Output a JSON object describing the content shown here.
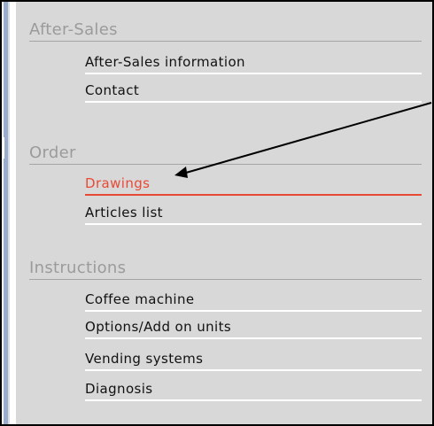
{
  "sections": [
    {
      "title": "After-Sales",
      "items": [
        "After-Sales information",
        "Contact"
      ]
    },
    {
      "title": "Order",
      "items": [
        "Drawings",
        "Articles list"
      ]
    },
    {
      "title": "Instructions",
      "items": [
        "Coffee machine",
        "Options/Add on units",
        "Vending systems",
        "Diagnosis"
      ]
    }
  ],
  "active_item": "Drawings",
  "colors": {
    "panel_background": "#d8d8d8",
    "section_title": "#9b9b9b",
    "active_link": "#e84a36",
    "left_strip": "#9aaccb"
  }
}
